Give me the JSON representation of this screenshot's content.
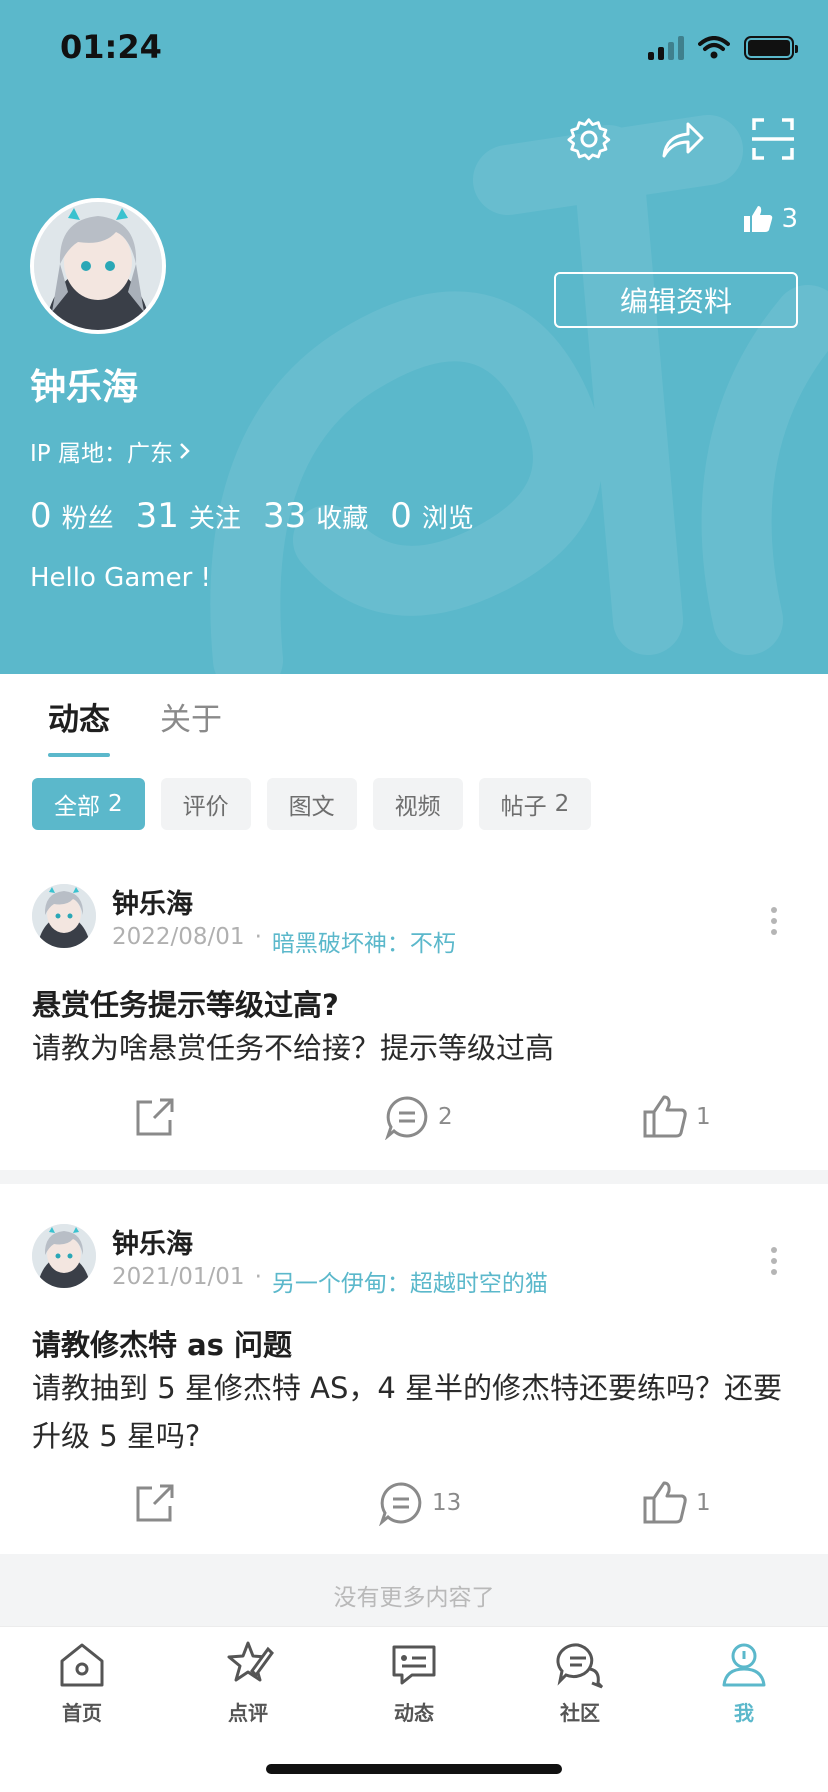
{
  "status_bar": {
    "time": "01:24"
  },
  "colors": {
    "accent": "#5bb8cb",
    "header_bg": "#5bb8cb"
  },
  "header": {
    "icons": [
      "gear-icon",
      "share-icon",
      "scan-icon"
    ],
    "likes_count": "3",
    "edit_button": "编辑资料",
    "username": "钟乐海",
    "ip_location": "IP 属地：广东",
    "stats": [
      {
        "value": "0",
        "label": "粉丝"
      },
      {
        "value": "31",
        "label": "关注"
      },
      {
        "value": "33",
        "label": "收藏"
      },
      {
        "value": "0",
        "label": "浏览"
      }
    ],
    "bio": "Hello Gamer !"
  },
  "tabs": [
    {
      "label": "动态",
      "active": true
    },
    {
      "label": "关于",
      "active": false
    }
  ],
  "filters": [
    {
      "label": "全部",
      "count": "2",
      "active": true
    },
    {
      "label": "评价",
      "count": "",
      "active": false
    },
    {
      "label": "图文",
      "count": "",
      "active": false
    },
    {
      "label": "视频",
      "count": "",
      "active": false
    },
    {
      "label": "帖子",
      "count": "2",
      "active": false
    }
  ],
  "posts": [
    {
      "author": "钟乐海",
      "date": "2022/08/01",
      "separator": "·",
      "game": "暗黑破坏神：不朽",
      "title": "悬赏任务提示等级过高?",
      "body": "请教为啥悬赏任务不给接？提示等级过高",
      "comments": "2",
      "likes": "1"
    },
    {
      "author": "钟乐海",
      "date": "2021/01/01",
      "separator": "·",
      "game": "另一个伊甸：超越时空的猫",
      "title": "请教修杰特 as 问题",
      "body": "请教抽到 5 星修杰特 AS，4 星半的修杰特还要练吗？还要升级 5 星吗?",
      "comments": "13",
      "likes": "1"
    }
  ],
  "end_text": "没有更多内容了",
  "bottom_nav": [
    {
      "label": "首页",
      "icon": "home-icon",
      "active": false
    },
    {
      "label": "点评",
      "icon": "review-pen-icon",
      "active": false
    },
    {
      "label": "动态",
      "icon": "feed-icon",
      "active": false
    },
    {
      "label": "社区",
      "icon": "community-chat-icon",
      "active": false
    },
    {
      "label": "我",
      "icon": "profile-icon",
      "active": true
    }
  ]
}
